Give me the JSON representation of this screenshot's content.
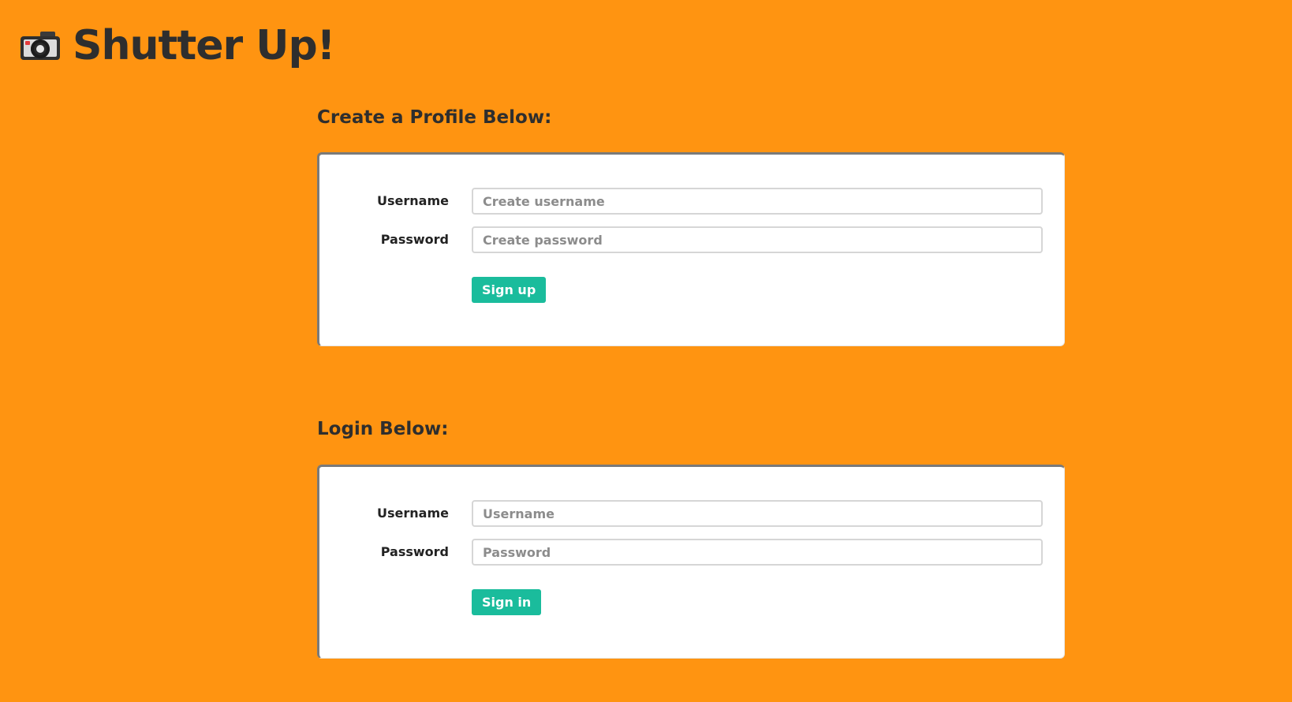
{
  "header": {
    "icon": "camera-icon",
    "title": "Shutter Up!"
  },
  "signup": {
    "heading": "Create a Profile Below:",
    "username_label": "Username",
    "username_placeholder": "Create username",
    "password_label": "Password",
    "password_placeholder": "Create password",
    "button_label": "Sign up"
  },
  "login": {
    "heading": "Login Below:",
    "username_label": "Username",
    "username_placeholder": "Username",
    "password_label": "Password",
    "password_placeholder": "Password",
    "button_label": "Sign in"
  },
  "colors": {
    "background": "#FF9411",
    "button": "#1ABC9C",
    "card": "#FFFFFF"
  }
}
